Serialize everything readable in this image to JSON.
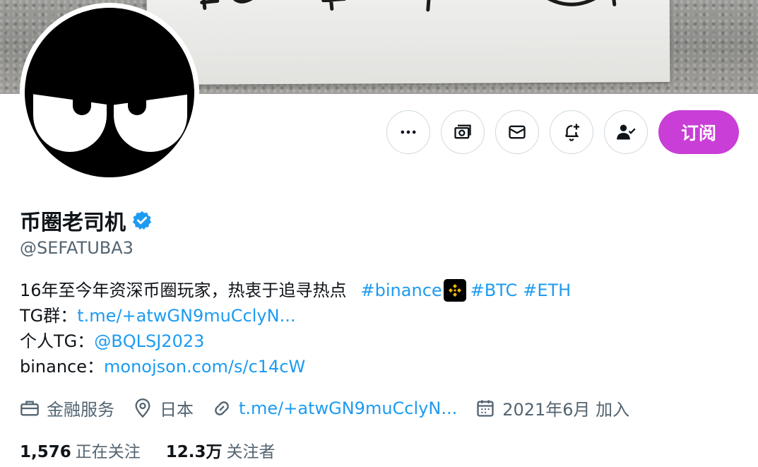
{
  "profile": {
    "name": "币圈老司机",
    "handle": "@SEFATUBA3",
    "subscribe_label": "订阅",
    "bio": {
      "line1_text": "16年至今年资深币圈玩家，热衷于追寻热点",
      "line1_tag1": "#binance",
      "line1_tag2": "#BTC",
      "line1_tag3": "#ETH",
      "line2_label": "TG群：",
      "line2_link": "t.me/+atwGN9muCclyN...",
      "line3_label": "个人TG：",
      "line3_link": "@BQLSJ2023",
      "line4_label": "binance：",
      "line4_link": "monojson.com/s/c14cW"
    },
    "meta": {
      "category": "金融服务",
      "location": "日本",
      "website": "t.me/+atwGN9muCclyN...",
      "joined": "2021年6月 加入"
    },
    "stats": {
      "following_count": "1,576",
      "following_label": "正在关注",
      "followers_count": "12.3万",
      "followers_label": "关注者"
    }
  },
  "icons": {
    "more": "more-icon",
    "tip": "tip-jar-icon",
    "message": "mail-icon",
    "notify": "bell-plus-icon",
    "following": "person-check-icon",
    "verified": "verified-badge-icon"
  },
  "colors": {
    "subscribe": "#c93ed6",
    "link": "#1d9bf0",
    "verified": "#1d9bf0",
    "secondary_text": "#536471"
  }
}
